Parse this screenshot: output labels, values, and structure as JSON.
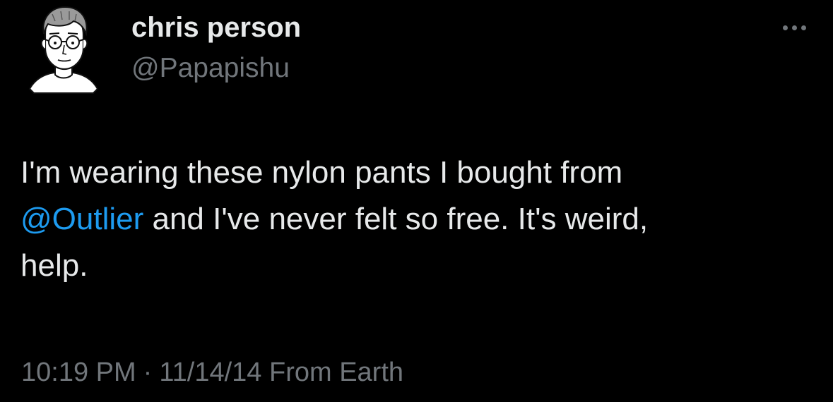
{
  "user": {
    "display_name": "chris person",
    "handle": "@Papapishu",
    "avatar_icon": "cartoon-portrait-avatar"
  },
  "menu": {
    "icon": "more-options-icon"
  },
  "tweet": {
    "line1": "I'm wearing these nylon pants I bought from",
    "mention": "@Outlier",
    "line2_rest": " and I've never felt so free. It's weird,",
    "line3": "help."
  },
  "meta": {
    "time": "10:19 PM",
    "separator": "·",
    "date": "11/14/14",
    "source": "From Earth"
  },
  "colors": {
    "background": "#000000",
    "primary_text": "#e7e9ea",
    "secondary_text": "#71767b",
    "mention": "#1d9bf0"
  }
}
